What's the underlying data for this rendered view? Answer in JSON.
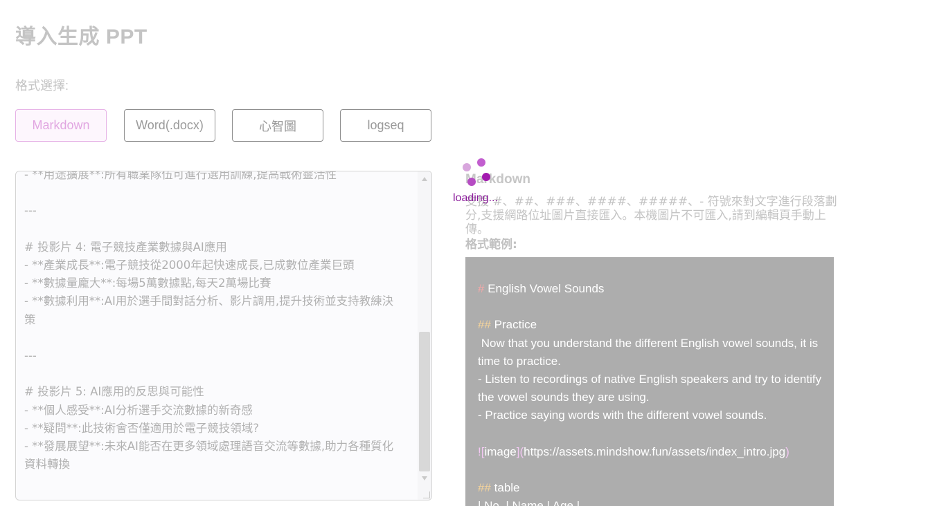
{
  "page": {
    "title": "導入生成 PPT",
    "format_label": "格式選擇:"
  },
  "formats": [
    {
      "label": "Markdown",
      "active": true
    },
    {
      "label": "Word(.docx)",
      "active": false
    },
    {
      "label": "心智圖",
      "active": false
    },
    {
      "label": "logseq",
      "active": false
    }
  ],
  "editor": {
    "lines": [
      "- **用途擴展**:所有職業隊伍可進行選用訓練,提高戰術靈活性",
      "",
      "---",
      "",
      "# 投影片 4: 電子競技產業數據與AI應用",
      "- **產業成長**:電子競技從2000年起快速成長,已成數位產業巨頭",
      "- **數據量龐大**:每場5萬數據點,每天2萬場比賽",
      "- **數據利用**:AI用於選手間對話分析、影片調用,提升技術並支持教練決",
      "策",
      "",
      "---",
      "",
      "# 投影片 5: AI應用的反思與可能性",
      "- **個人感受**:AI分析選手交流數據的新奇感",
      "- **疑問**:此技術會否僅適用於電子競技領域?",
      "- **發展展望**:未來AI能否在更多領域處理語音交流等數據,助力各種質化",
      "資料轉換"
    ]
  },
  "info": {
    "title": "Markdown",
    "description": "支援 #、##、###、####、#####、- 符號來對文字進行段落劃分,支援網路位址圖片直接匯入。本機圖片不可匯入,請到編輯頁手動上傳。",
    "example_label": "格式範例:"
  },
  "example": {
    "h1_mark": "#",
    "h1_text": " English Vowel Sounds",
    "h2_mark": "##",
    "h2_text": " Practice",
    "para1": " Now that you understand the different English vowel sounds, it is time to practice.",
    "bullet1": "- Listen to recordings of native English speakers and try to identify the vowel sounds they are using.",
    "bullet2": "- Practice saying words with the different vowel sounds.",
    "img_mark_open": "![",
    "img_alt": "image",
    "img_mark_mid": "](",
    "img_url": "https://assets.mindshow.fun/assets/index_intro.jpg",
    "img_mark_close": ")",
    "h2b_mark": "##",
    "h2b_text": " table",
    "table_row": "| No. | Name | Age |"
  },
  "loading": {
    "text": "loading..."
  },
  "colors": {
    "accent": "#e1a6e1",
    "loading_dot": "#b32fbf",
    "loading_text": "#8a1a9a"
  }
}
